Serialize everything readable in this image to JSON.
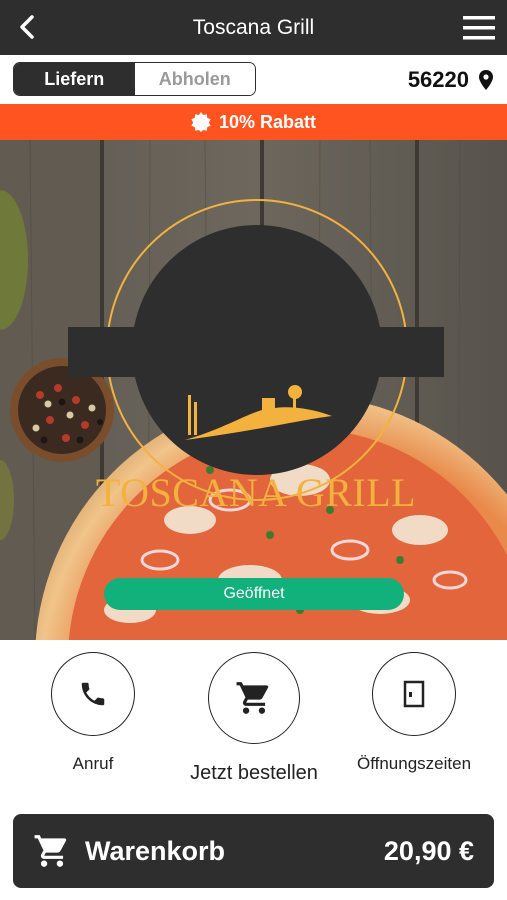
{
  "header": {
    "title": "Toscana Grill"
  },
  "mode": {
    "options": [
      "Liefern",
      "Abholen"
    ],
    "selected": "Liefern"
  },
  "location": {
    "postcode": "56220"
  },
  "promo": {
    "text": "10% Rabatt"
  },
  "hero": {
    "logo_text": "TOSCANA GRILL",
    "status": "Geöffnet"
  },
  "actions": [
    {
      "label": "Anruf",
      "icon": "phone-icon"
    },
    {
      "label": "Jetzt bestellen",
      "icon": "cart-icon"
    },
    {
      "label": "Öffnungszeiten",
      "icon": "door-icon"
    }
  ],
  "cart": {
    "label": "Warenkorb",
    "total": "20,90 €"
  },
  "colors": {
    "dark": "#2e2e2e",
    "accent": "#ff5420",
    "open_green": "#12b07a",
    "logo_gold": "#f3b13e"
  }
}
